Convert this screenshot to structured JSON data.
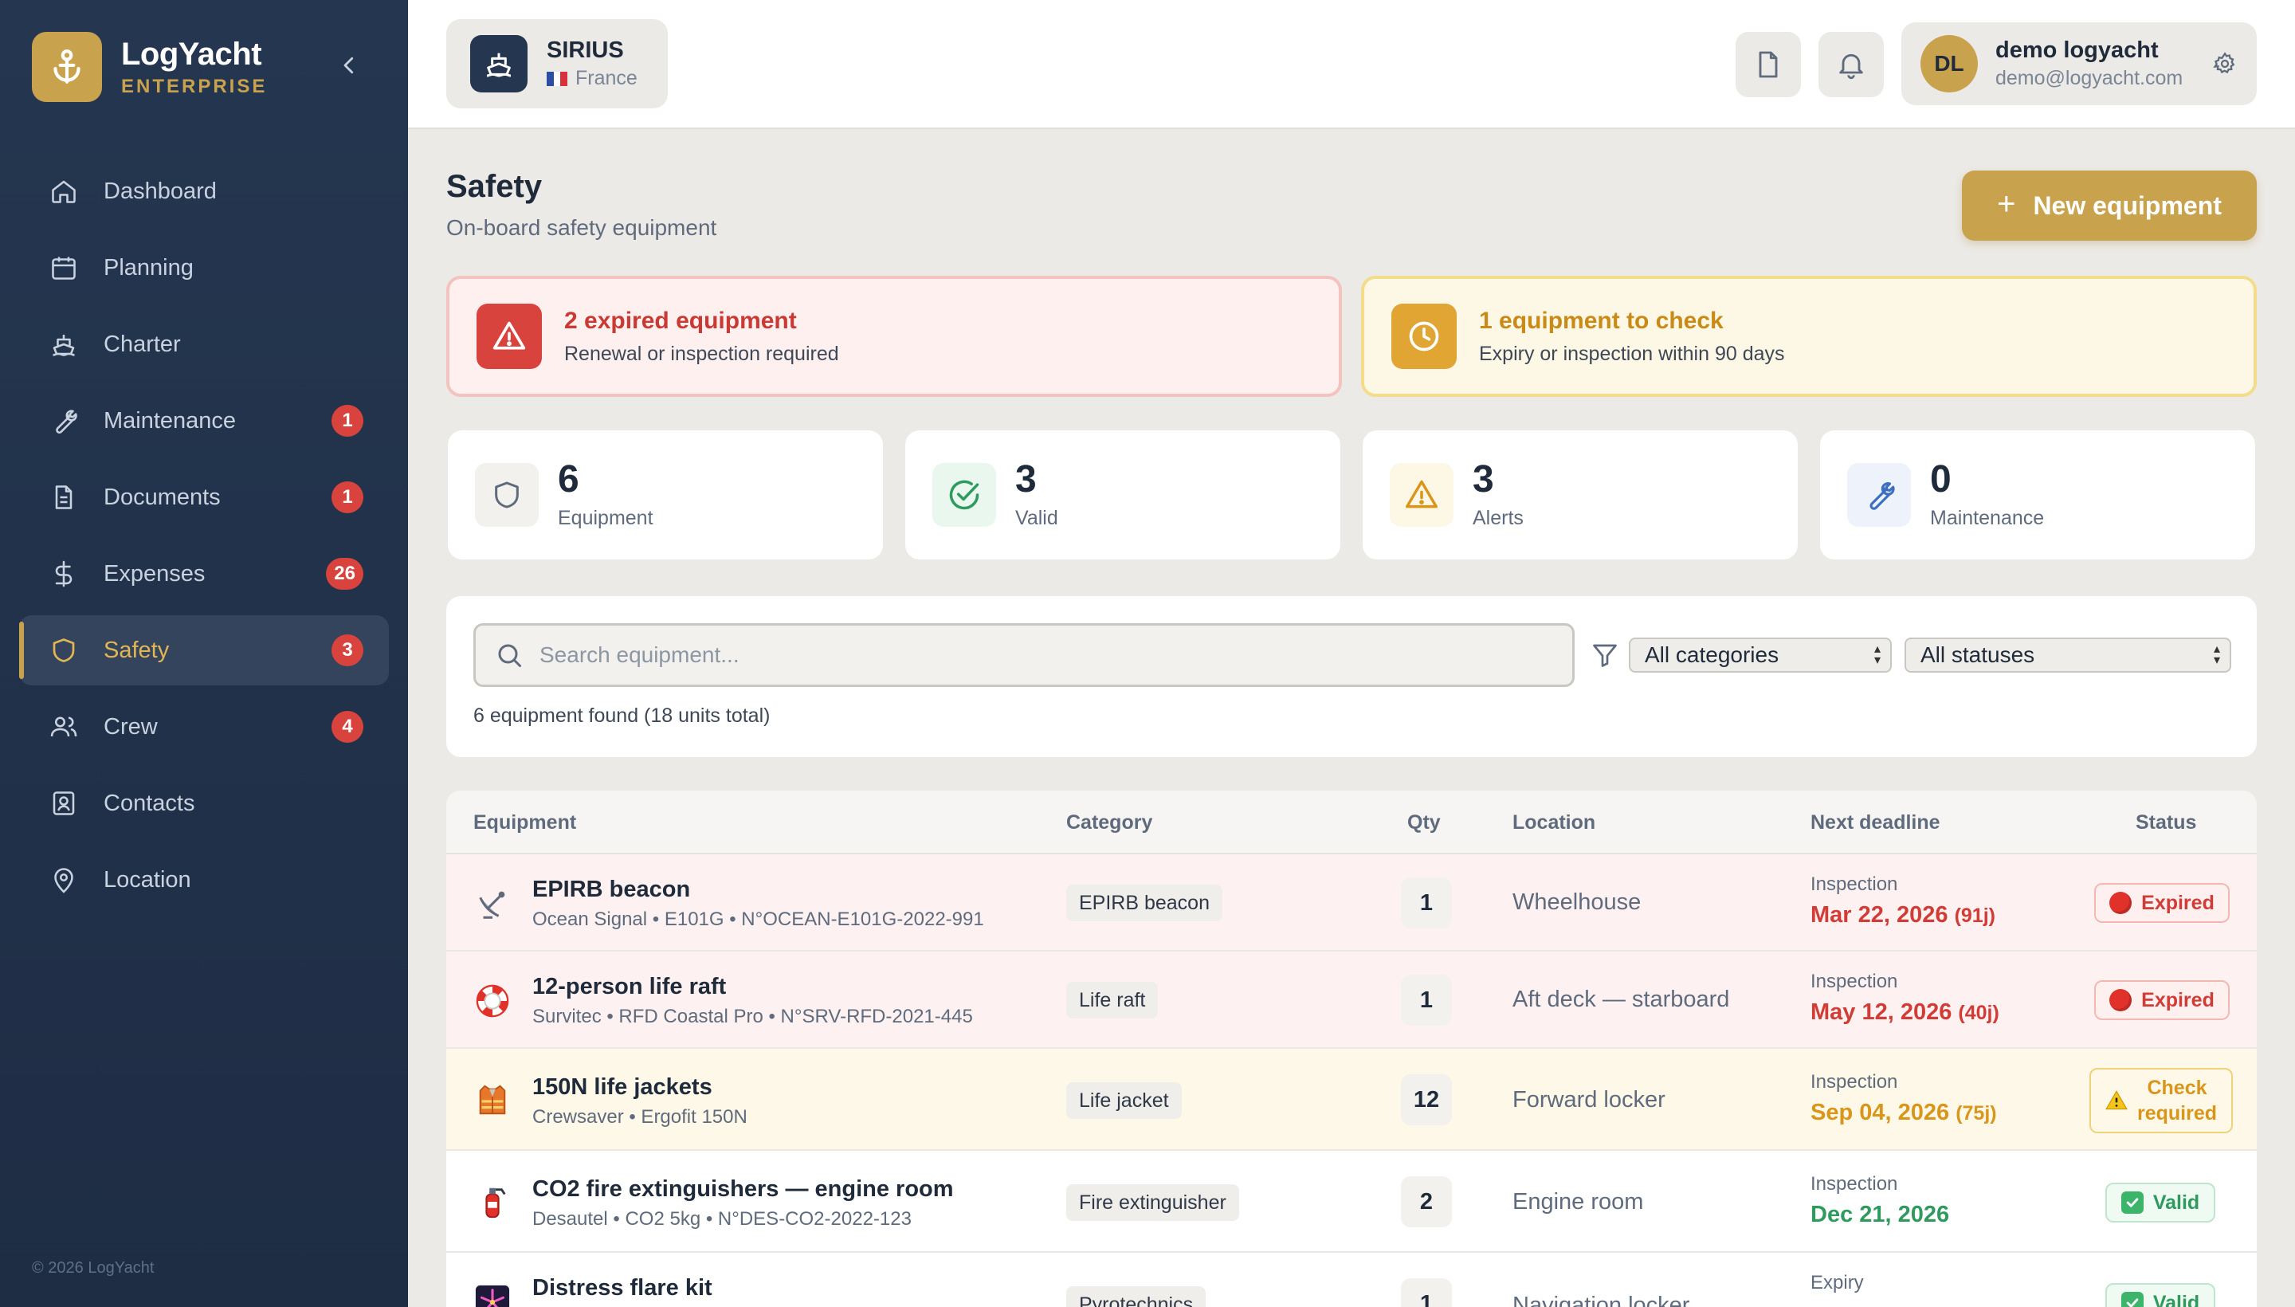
{
  "brand": {
    "name": "LogYacht",
    "edition": "ENTERPRISE"
  },
  "sidebar": {
    "items": [
      {
        "label": "Dashboard",
        "icon": "home-icon",
        "badge": ""
      },
      {
        "label": "Planning",
        "icon": "calendar-icon",
        "badge": ""
      },
      {
        "label": "Charter",
        "icon": "ship-icon",
        "badge": ""
      },
      {
        "label": "Maintenance",
        "icon": "wrench-icon",
        "badge": "1"
      },
      {
        "label": "Documents",
        "icon": "document-icon",
        "badge": "1"
      },
      {
        "label": "Expenses",
        "icon": "dollar-icon",
        "badge": "26"
      },
      {
        "label": "Safety",
        "icon": "shield-icon",
        "badge": "3",
        "active": true
      },
      {
        "label": "Crew",
        "icon": "users-icon",
        "badge": "4"
      },
      {
        "label": "Contacts",
        "icon": "contact-card-icon",
        "badge": ""
      },
      {
        "label": "Location",
        "icon": "map-pin-icon",
        "badge": ""
      }
    ],
    "copyright": "© 2026 LogYacht"
  },
  "vessel": {
    "name": "SIRIUS",
    "country": "France"
  },
  "user": {
    "initials": "DL",
    "name": "demo logyacht",
    "email": "demo@logyacht.com"
  },
  "page": {
    "title": "Safety",
    "subtitle": "On-board safety equipment",
    "new_button": "New equipment"
  },
  "alerts": {
    "expired": {
      "title": "2 expired equipment",
      "desc": "Renewal or inspection required"
    },
    "check": {
      "title": "1 equipment to check",
      "desc": "Expiry or inspection within 90 days"
    }
  },
  "stats": [
    {
      "value": "6",
      "label": "Equipment",
      "icon": "shield-icon"
    },
    {
      "value": "3",
      "label": "Valid",
      "icon": "check-circle-icon"
    },
    {
      "value": "3",
      "label": "Alerts",
      "icon": "warning-icon"
    },
    {
      "value": "0",
      "label": "Maintenance",
      "icon": "wrench-icon"
    }
  ],
  "filters": {
    "search_placeholder": "Search equipment...",
    "category": "All categories",
    "status": "All statuses",
    "found": "6 equipment found (18 units total)"
  },
  "table": {
    "headers": {
      "equipment": "Equipment",
      "category": "Category",
      "qty": "Qty",
      "location": "Location",
      "deadline": "Next deadline",
      "status": "Status"
    },
    "rows": [
      {
        "name": "EPIRB beacon",
        "desc": "Ocean Signal • E101G • N°OCEAN-E101G-2022-991",
        "category": "EPIRB beacon",
        "qty": "1",
        "location": "Wheelhouse",
        "deadline_type": "Inspection",
        "deadline_date": "Mar 22, 2026",
        "deadline_rel": "(91j)",
        "status": "Expired",
        "icon": "satellite-dish-icon"
      },
      {
        "name": "12-person life raft",
        "desc": "Survitec • RFD Coastal Pro • N°SRV-RFD-2021-445",
        "category": "Life raft",
        "qty": "1",
        "location": "Aft deck — starboard",
        "deadline_type": "Inspection",
        "deadline_date": "May 12, 2026",
        "deadline_rel": "(40j)",
        "status": "Expired",
        "icon": "life-ring-icon"
      },
      {
        "name": "150N life jackets",
        "desc": "Crewsaver • Ergofit 150N",
        "category": "Life jacket",
        "qty": "12",
        "location": "Forward locker",
        "deadline_type": "Inspection",
        "deadline_date": "Sep 04, 2026",
        "deadline_rel": "(75j)",
        "status_line1": "Check",
        "status_line2": "required",
        "icon": "life-vest-icon"
      },
      {
        "name": "CO2 fire extinguishers — engine room",
        "desc": "Desautel • CO2 5kg • N°DES-CO2-2022-123",
        "category": "Fire extinguisher",
        "qty": "2",
        "location": "Engine room",
        "deadline_type": "Inspection",
        "deadline_date": "Dec 21, 2026",
        "deadline_rel": "",
        "status": "Valid",
        "icon": "fire-extinguisher-icon"
      },
      {
        "name": "Distress flare kit",
        "desc": "",
        "category": "Pyrotechnics",
        "qty": "1",
        "location": "Navigation locker",
        "deadline_type": "Expiry",
        "deadline_date": "",
        "deadline_rel": "",
        "status": "Valid",
        "icon": "fireworks-icon"
      }
    ]
  },
  "colors": {
    "accent": "#c9a24e",
    "sidebar": "#253650",
    "danger": "#d9433d",
    "warning": "#e0a532",
    "success": "#2f9a5e"
  }
}
